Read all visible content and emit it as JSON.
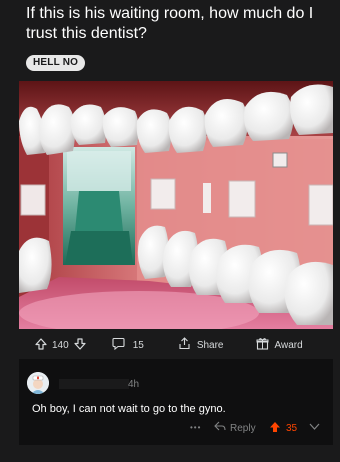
{
  "post": {
    "title": "If this is his waiting room, how much do I trust this dentist?",
    "flair": "HELL NO"
  },
  "actions": {
    "upvotes": "140",
    "comments": "15",
    "share_label": "Share",
    "award_label": "Award"
  },
  "comment": {
    "time": "4h",
    "text": "Oh boy, I can not wait to go to the gyno.",
    "more": "•••",
    "reply_label": "Reply",
    "score": "35"
  },
  "colors": {
    "background": "#1a1a1b",
    "upvote_accent": "#ff4500",
    "muted_text": "#818384"
  },
  "icons": [
    "upvote-icon",
    "downvote-icon",
    "comment-icon",
    "share-icon",
    "award-icon",
    "reply-icon",
    "collapse-chevron-icon"
  ]
}
